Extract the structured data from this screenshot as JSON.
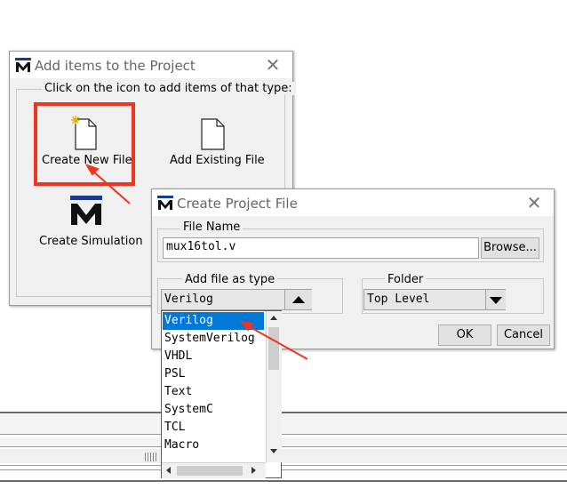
{
  "add_items_dialog": {
    "title": "Add items to the Project",
    "group_label": "Click on the icon to add items of that type:",
    "items": [
      {
        "label": "Create New File"
      },
      {
        "label": "Add Existing File"
      },
      {
        "label": "Create Simulation"
      }
    ]
  },
  "create_file_dialog": {
    "title": "Create Project File",
    "file_name_label": "File Name",
    "file_name_value": "mux16tol.v",
    "browse_label": "Browse...",
    "add_as_type_label": "Add file as type",
    "type_value": "Verilog",
    "folder_label": "Folder",
    "folder_value": "Top Level",
    "ok_label": "OK",
    "cancel_label": "Cancel"
  },
  "type_dropdown": {
    "options": [
      "Verilog",
      "SystemVerilog",
      "VHDL",
      "PSL",
      "Text",
      "SystemC",
      "TCL",
      "Macro"
    ],
    "selected": "Verilog"
  },
  "colors": {
    "highlight": "#0078d7",
    "annotation_red": "#f0341f",
    "dialog_bg": "#f0f0f0",
    "logo_blue": "#1a3b8c"
  },
  "icons": [
    "app-logo-icon",
    "close-icon",
    "new-file-icon",
    "existing-file-icon",
    "simulation-icon",
    "up-arrow-icon",
    "down-arrow-icon",
    "left-arrow-icon",
    "right-arrow-icon"
  ]
}
